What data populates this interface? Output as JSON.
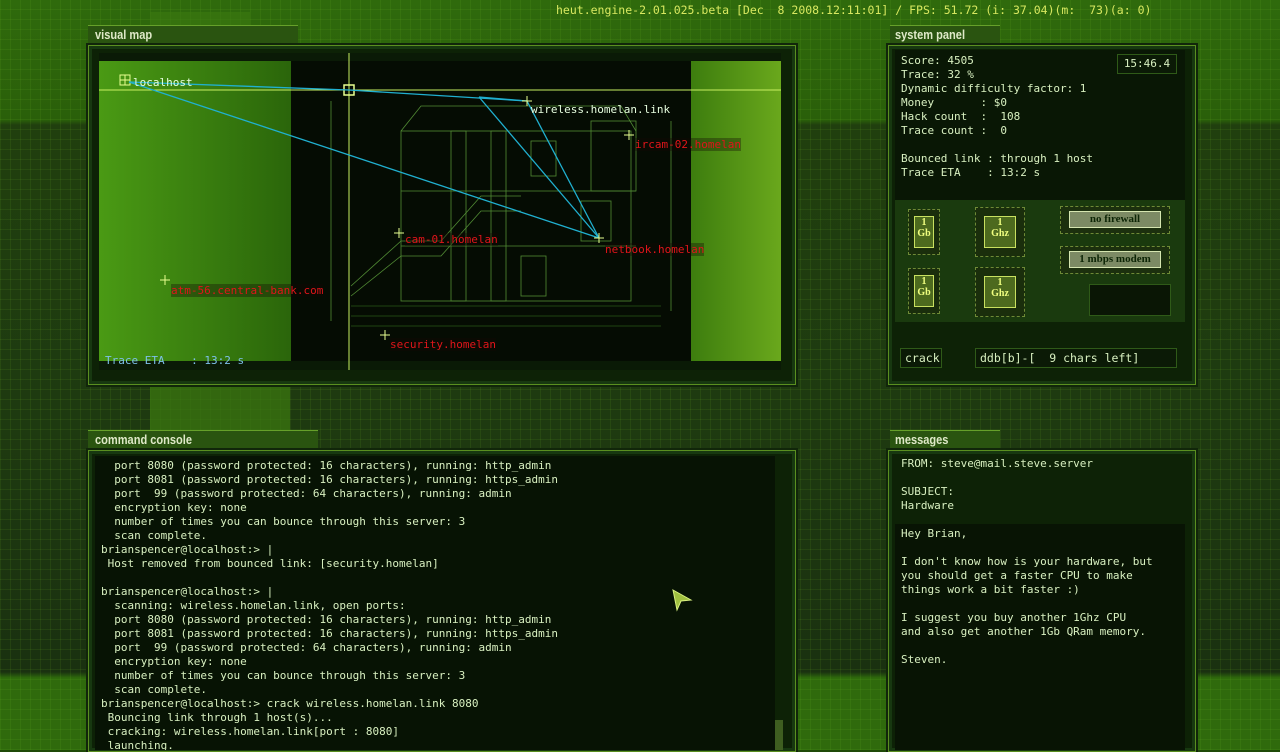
{
  "header": {
    "engine_info": "heut.engine-2.01.025.beta [Dec  8 2008.12:11:01] / FPS: 51.72 (i: 37.04)(m:  73)(a: 0)"
  },
  "visual_map": {
    "title": "visual map",
    "trace_eta_label": "Trace ETA    : 13:2 s",
    "nodes": {
      "localhost": "localhost",
      "wireless": "wireless.homelan.link",
      "ircam": "ircam-02.homelan",
      "cam": "cam-01.homelan",
      "netbook": "netbook.homelan",
      "atm": "atm-56.central-bank.com",
      "security": "security.homelan"
    },
    "colors": {
      "link_line": "#20b0d0",
      "node_red": "#e0151a",
      "crosshair": "#c8f060"
    }
  },
  "system_panel": {
    "title": "system panel",
    "clock": "15:46.4",
    "score": "Score: 4505",
    "trace": "Trace: 32 %",
    "difficulty": "Dynamic difficulty factor: 1",
    "money": "Money       : $0",
    "hack_count": "Hack count  :  108",
    "trace_count": "Trace count :  0",
    "bounced_link": "Bounced link : through 1 host",
    "trace_eta": "Trace ETA    : 13:2 s",
    "hardware": {
      "ram1": "1\nGb",
      "cpu1": "1\nGhz",
      "ram2": "1\nGb",
      "cpu2": "1\nGhz",
      "firewall": "no firewall",
      "modem": "1 mbps modem"
    },
    "crack_label": "crack",
    "crack_input": "ddb[b]-[  9 chars left]"
  },
  "command_console": {
    "title": "command console",
    "lines": [
      "  port 8080 (password protected: 16 characters), running: http_admin",
      "  port 8081 (password protected: 16 characters), running: https_admin",
      "  port  99 (password protected: 64 characters), running: admin",
      "  encryption key: none",
      "  number of times you can bounce through this server: 3",
      "  scan complete.",
      "brianspencer@localhost:> |",
      " Host removed from bounced link: [security.homelan]",
      "",
      "brianspencer@localhost:> |",
      "  scanning: wireless.homelan.link, open ports:",
      "  port 8080 (password protected: 16 characters), running: http_admin",
      "  port 8081 (password protected: 16 characters), running: https_admin",
      "  port  99 (password protected: 64 characters), running: admin",
      "  encryption key: none",
      "  number of times you can bounce through this server: 3",
      "  scan complete.",
      "brianspencer@localhost:> crack wireless.homelan.link 8080",
      " Bouncing link through 1 host(s)...",
      " cracking: wireless.homelan.link[port : 8080]",
      " launching."
    ]
  },
  "messages": {
    "title": "messages",
    "from": "FROM: steve@mail.steve.server",
    "subject_label": "SUBJECT:",
    "subject": "Hardware",
    "body": "Hey Brian,\n\nI don't know how is your hardware, but\nyou should get a faster CPU to make\nthings work a bit faster :)\n\nI suggest you buy another 1Ghz CPU\nand also get another 1Gb QRam memory.\n\nSteven."
  }
}
